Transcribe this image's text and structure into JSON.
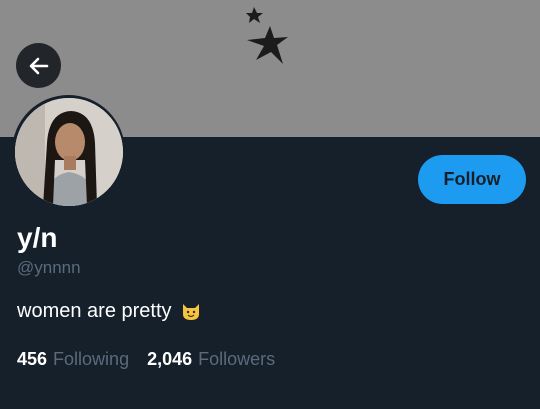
{
  "profile": {
    "display_name": "y/n",
    "handle": "@ynnnn",
    "bio": "women are pretty",
    "bio_emoji": "smiling-cat-emoji",
    "follow_label": "Follow",
    "following_count": "456",
    "following_label": "Following",
    "followers_count": "2,046",
    "followers_label": "Followers"
  },
  "header": {
    "back_icon": "arrow-left-icon"
  },
  "colors": {
    "background": "#15202b",
    "banner": "#8c8c8c",
    "accent": "#1d9bf0",
    "secondary_text": "#5b6b7a"
  }
}
